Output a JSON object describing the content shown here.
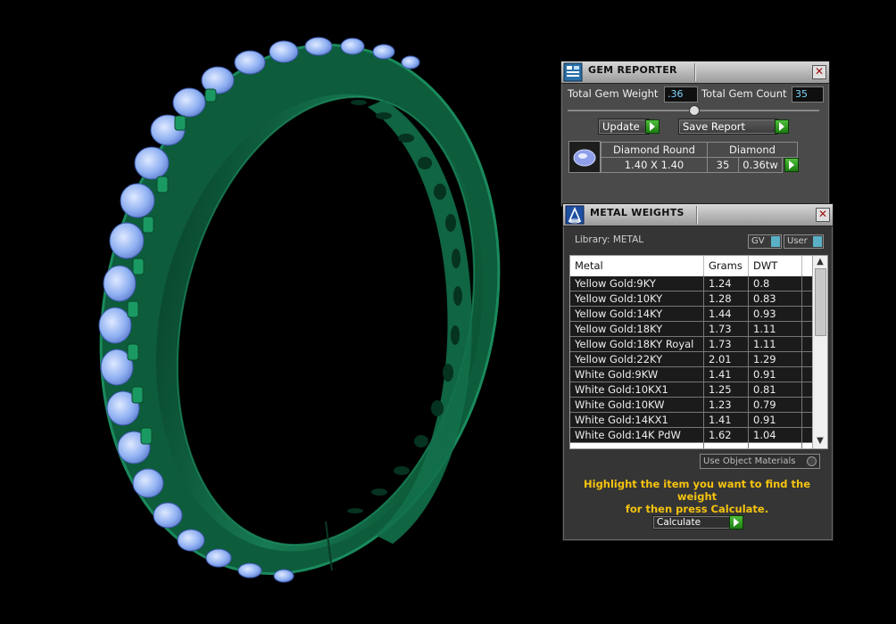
{
  "gem_reporter": {
    "title": "GEM REPORTER",
    "total_weight_label": "Total Gem Weight",
    "total_weight_value": ".36",
    "total_count_label": "Total Gem Count",
    "total_count_value": "35",
    "update_label": "Update",
    "save_label": "Save Report",
    "gem": {
      "cut": "Diamond Round",
      "type": "Diamond",
      "size": "1.40 X 1.40",
      "count": "35",
      "weight": "0.36tw"
    }
  },
  "metal_weights": {
    "title": "METAL WEIGHTS",
    "library_label": "Library: METAL",
    "gv_label": "GV",
    "user_label": "User",
    "columns": [
      "Metal",
      "Grams",
      "DWT"
    ],
    "rows": [
      {
        "metal": "Yellow Gold:9KY",
        "grams": "1.24",
        "dwt": "0.8"
      },
      {
        "metal": "Yellow Gold:10KY",
        "grams": "1.28",
        "dwt": "0.83"
      },
      {
        "metal": "Yellow Gold:14KY",
        "grams": "1.44",
        "dwt": "0.93"
      },
      {
        "metal": "Yellow Gold:18KY",
        "grams": "1.73",
        "dwt": "1.11"
      },
      {
        "metal": "Yellow Gold:18KY Royal",
        "grams": "1.73",
        "dwt": "1.11"
      },
      {
        "metal": "Yellow Gold:22KY",
        "grams": "2.01",
        "dwt": "1.29"
      },
      {
        "metal": "White Gold:9KW",
        "grams": "1.41",
        "dwt": "0.91"
      },
      {
        "metal": "White Gold:10KX1",
        "grams": "1.25",
        "dwt": "0.81"
      },
      {
        "metal": "White Gold:10KW",
        "grams": "1.23",
        "dwt": "0.79"
      },
      {
        "metal": "White Gold:14KX1",
        "grams": "1.41",
        "dwt": "0.91"
      },
      {
        "metal": "White Gold:14K PdW",
        "grams": "1.62",
        "dwt": "1.04"
      }
    ],
    "use_object_materials_label": "Use Object Materials",
    "hint_line1": "Highlight the item you want to find the weight",
    "hint_line2": "for then press Calculate.",
    "calculate_label": "Calculate"
  },
  "colors": {
    "ring_green": "#0f6b45",
    "gem_blue": "#8fb4f5",
    "hint_yellow": "#f5c30f",
    "value_cyan": "#7fd7ff"
  }
}
